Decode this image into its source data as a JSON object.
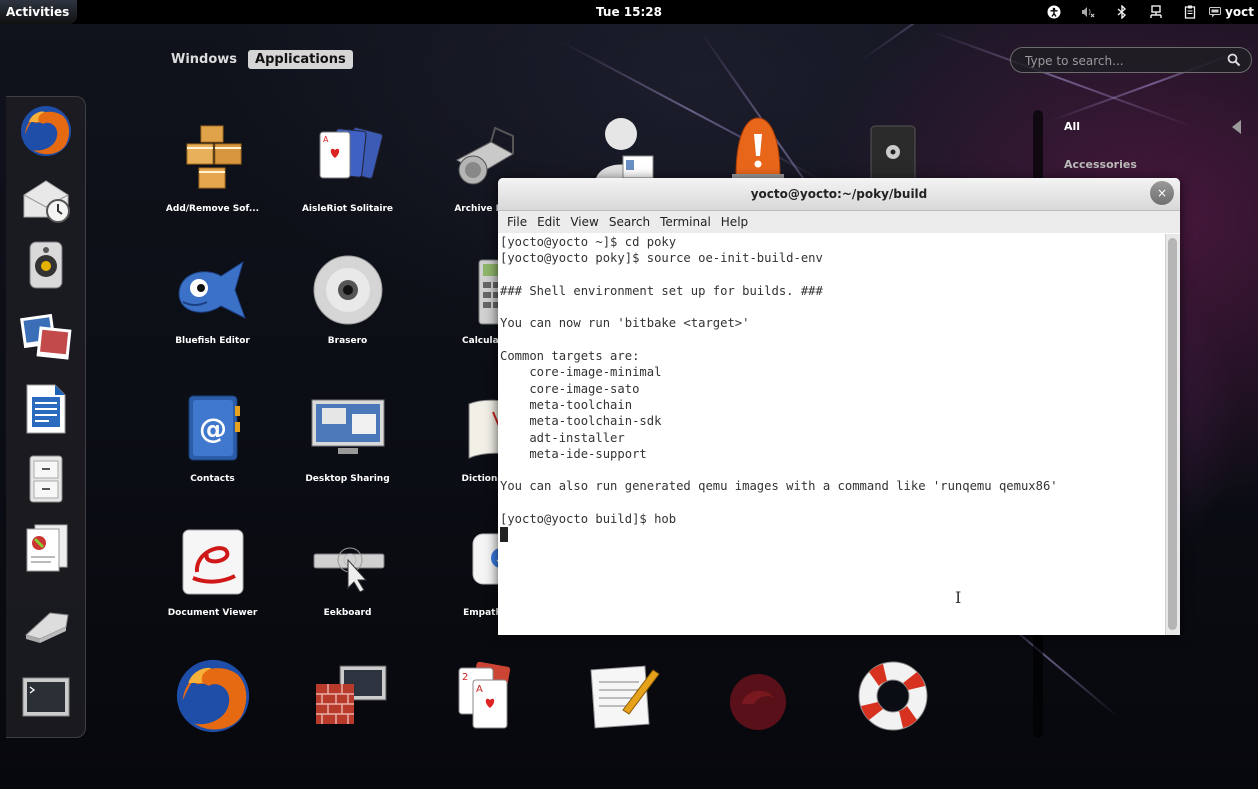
{
  "topbar": {
    "activities": "Activities",
    "clock": "Tue 15:28",
    "user": "yoct"
  },
  "overview": {
    "tabs": [
      {
        "label": "Windows",
        "active": false
      },
      {
        "label": "Applications",
        "active": true
      }
    ],
    "search_placeholder": "Type to search..."
  },
  "dash": {
    "items": [
      "firefox-icon",
      "mail-clock-icon",
      "speaker-icon",
      "photos-icon",
      "writer-icon",
      "file-cabinet-icon",
      "documents-icon",
      "drive-icon",
      "terminal-icon"
    ]
  },
  "apps": [
    {
      "label": "Add/Remove Sof...",
      "icon": "packages-icon"
    },
    {
      "label": "AisleRiot Solitaire",
      "icon": "playing-cards-icon"
    },
    {
      "label": "Archive Ma",
      "icon": "archive-icon"
    },
    {
      "label": "",
      "icon": "contact-card-icon"
    },
    {
      "label": "",
      "icon": "alarm-icon"
    },
    {
      "label": "",
      "icon": "safe-icon"
    },
    {
      "label": "Bluefish Editor",
      "icon": "bluefish-icon"
    },
    {
      "label": "Brasero",
      "icon": "disc-icon"
    },
    {
      "label": "Calculat",
      "icon": "calculator-icon"
    },
    {
      "label": "Contacts",
      "icon": "address-book-icon"
    },
    {
      "label": "Desktop Sharing",
      "icon": "desktop-sharing-icon"
    },
    {
      "label": "Dictiona",
      "icon": "dictionary-icon"
    },
    {
      "label": "Document Viewer",
      "icon": "document-viewer-icon"
    },
    {
      "label": "Eekboard",
      "icon": "keyboard-icon"
    },
    {
      "label": "Empath",
      "icon": "chat-icon"
    },
    {
      "label": "",
      "icon": "firefox-icon"
    },
    {
      "label": "",
      "icon": "firewall-icon"
    },
    {
      "label": "",
      "icon": "cards-icon"
    },
    {
      "label": "",
      "icon": "text-editor-icon"
    },
    {
      "label": "",
      "icon": "unknown-icon"
    },
    {
      "label": "",
      "icon": "lifebuoy-icon"
    }
  ],
  "categories": [
    {
      "label": "All",
      "selected": true
    },
    {
      "label": "Accessories",
      "selected": false
    }
  ],
  "terminal": {
    "title": "yocto@yocto:~/poky/build",
    "menu": [
      "File",
      "Edit",
      "View",
      "Search",
      "Terminal",
      "Help"
    ],
    "lines": [
      "[yocto@yocto ~]$ cd poky",
      "[yocto@yocto poky]$ source oe-init-build-env",
      "",
      "### Shell environment set up for builds. ###",
      "",
      "You can now run 'bitbake <target>'",
      "",
      "Common targets are:",
      "    core-image-minimal",
      "    core-image-sato",
      "    meta-toolchain",
      "    meta-toolchain-sdk",
      "    adt-installer",
      "    meta-ide-support",
      "",
      "You can also run generated qemu images with a command like 'runqemu qemux86'",
      "",
      "[yocto@yocto build]$ hob"
    ],
    "close_symbol": "×"
  },
  "colors": {
    "topbar": "#000000",
    "terminal_bg": "#ffffff",
    "terminal_fg": "#333333"
  }
}
